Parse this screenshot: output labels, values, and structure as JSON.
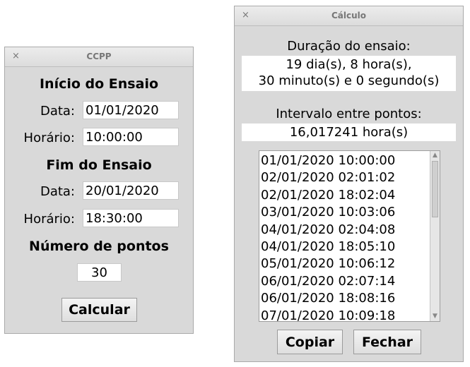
{
  "ccpp": {
    "title": "CCPP",
    "close": "×",
    "start_heading": "Início do Ensaio",
    "date_label": "Data:",
    "date_value": "01/01/2020",
    "time_label": "Horário:",
    "time_value": "10:00:00",
    "end_heading": "Fim do Ensaio",
    "end_date_label": "Data:",
    "end_date_value": "20/01/2020",
    "end_time_label": "Horário:",
    "end_time_value": "18:30:00",
    "points_heading": "Número de pontos",
    "points_value": "30",
    "calculate_button": "Calcular"
  },
  "calculo": {
    "title": "Cálculo",
    "close": "×",
    "duration_heading": "Duração do ensaio:",
    "duration_line1": "19 dia(s), 8 hora(s),",
    "duration_line2": "30 minuto(s) e 0 segundo(s)",
    "interval_heading": "Intervalo entre pontos:",
    "interval_value": "16,017241 hora(s)",
    "points": [
      "01/01/2020 10:00:00",
      "02/01/2020 02:01:02",
      "02/01/2020 18:02:04",
      "03/01/2020 10:03:06",
      "04/01/2020 02:04:08",
      "04/01/2020 18:05:10",
      "05/01/2020 10:06:12",
      "06/01/2020 02:07:14",
      "06/01/2020 18:08:16",
      "07/01/2020 10:09:18"
    ],
    "scroll_up": "▲",
    "scroll_down": "▼",
    "copy_button": "Copiar",
    "close_button": "Fechar"
  }
}
